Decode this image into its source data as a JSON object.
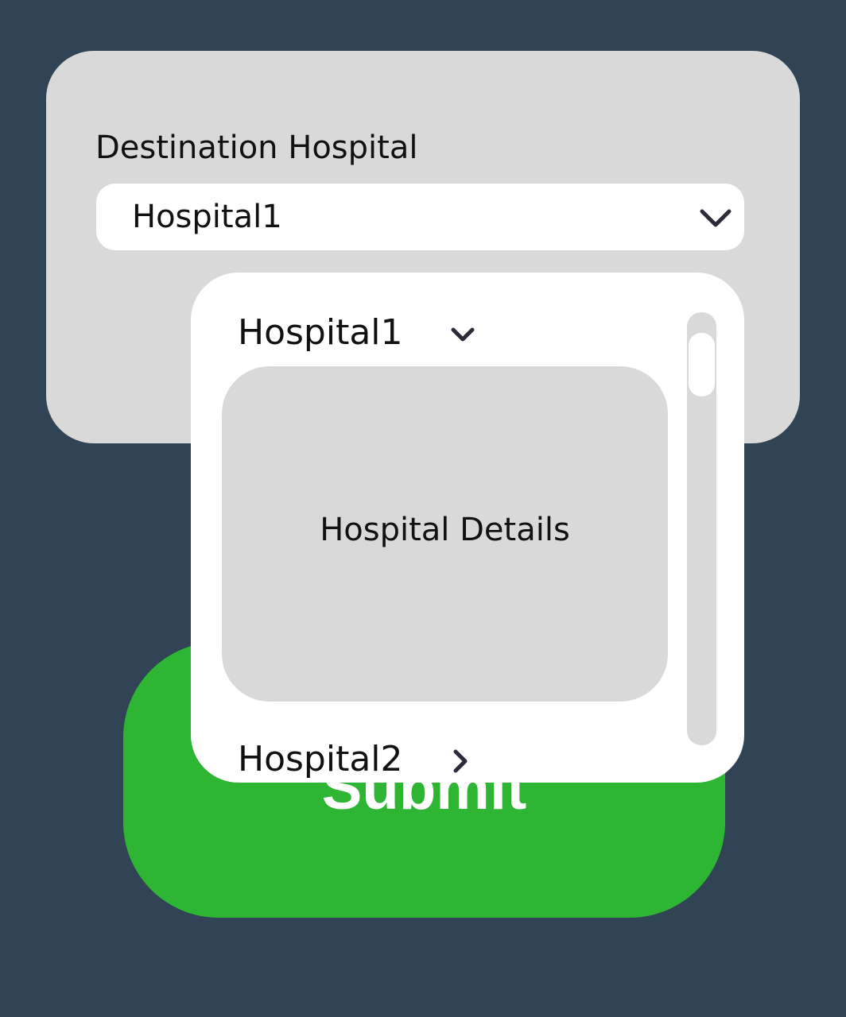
{
  "form": {
    "label": "Destination Hospital",
    "select_value": "Hospital1"
  },
  "dropdown": {
    "options": [
      {
        "label": "Hospital1",
        "expanded": true,
        "details": "Hospital Details"
      },
      {
        "label": "Hospital2",
        "expanded": false
      }
    ]
  },
  "submit": {
    "label": "Submit"
  },
  "colors": {
    "background": "#304456",
    "card": "#d9d9d9",
    "submit": "#2db533"
  }
}
